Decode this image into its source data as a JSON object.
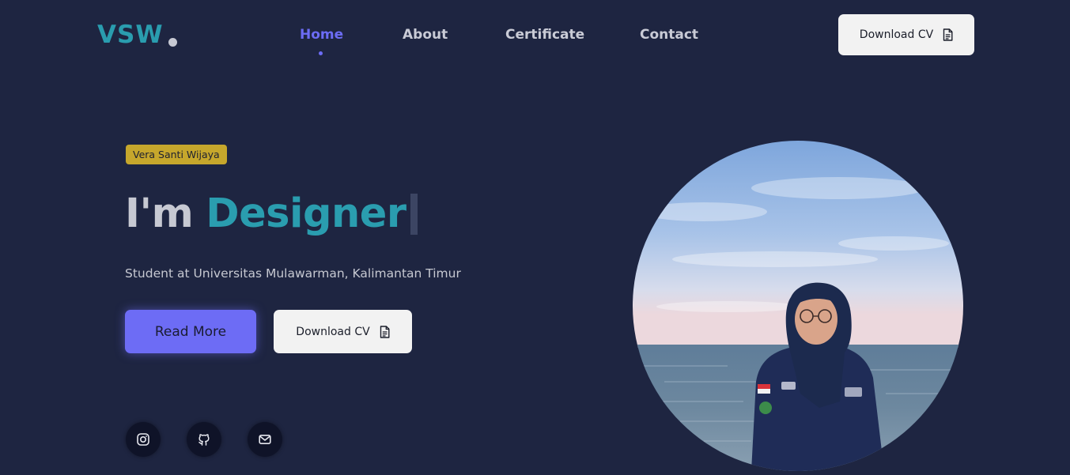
{
  "brand": {
    "logo_text": "VSW"
  },
  "nav": {
    "items": [
      {
        "label": "Home",
        "active": true
      },
      {
        "label": "About",
        "active": false
      },
      {
        "label": "Certificate",
        "active": false
      },
      {
        "label": "Contact",
        "active": false
      }
    ]
  },
  "header": {
    "download_cv_label": "Download CV",
    "download_cv_icon": "file-text-icon"
  },
  "hero": {
    "name_badge": "Vera Santi Wijaya",
    "headline_prefix": "I'm",
    "headline_role": "Designer",
    "subtitle": "Student at Universitas Mulawarman, Kalimantan Timur",
    "read_more_label": "Read More",
    "download_cv_label": "Download CV",
    "download_cv_icon": "file-text-icon"
  },
  "social": [
    {
      "icon": "instagram-icon"
    },
    {
      "icon": "github-icon"
    },
    {
      "icon": "mail-icon"
    }
  ],
  "colors": {
    "background": "#1e2541",
    "accent_teal": "#2a9daf",
    "accent_purple": "#6d6cf5",
    "badge_gold": "#c6a72c",
    "light_button": "#f2f2f2"
  }
}
